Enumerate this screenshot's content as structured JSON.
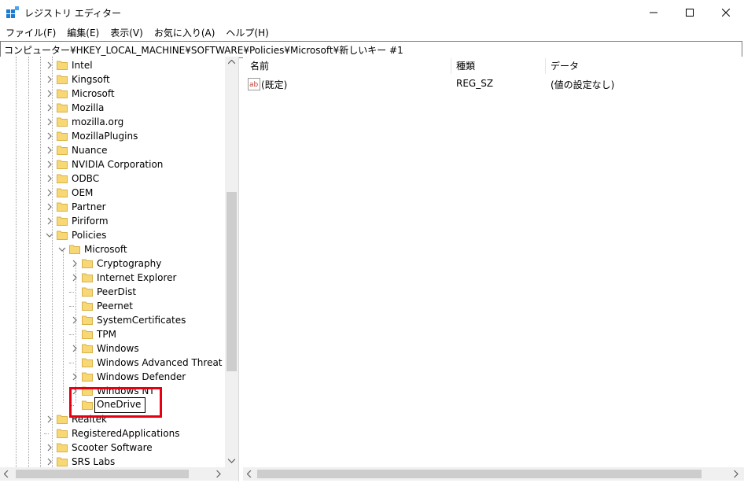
{
  "window": {
    "title": "レジストリ エディター"
  },
  "menu": [
    "ファイル(F)",
    "編集(E)",
    "表示(V)",
    "お気に入り(A)",
    "ヘルプ(H)"
  ],
  "address": "コンピューター¥HKEY_LOCAL_MACHINE¥SOFTWARE¥Policies¥Microsoft¥新しいキー #1",
  "tree": {
    "top_level": [
      "Intel",
      "Kingsoft",
      "Microsoft",
      "Mozilla",
      "mozilla.org",
      "MozillaPlugins",
      "Nuance",
      "NVIDIA Corporation",
      "ODBC",
      "OEM",
      "Partner",
      "Piriform",
      "Policies"
    ],
    "policies_child": "Microsoft",
    "microsoft_children": [
      "Cryptography",
      "Internet Explorer",
      "PeerDist",
      "Peernet",
      "SystemCertificates",
      "TPM",
      "Windows",
      "Windows Advanced Threat Pro",
      "Windows Defender",
      "Windows NT"
    ],
    "rename_value": "OneDrive",
    "after": [
      "Realtek",
      "RegisteredApplications",
      "Scooter Software",
      "SRS Labs"
    ]
  },
  "values": {
    "headers": {
      "name": "名前",
      "type": "種類",
      "data": "データ"
    },
    "rows": [
      {
        "name": "(既定)",
        "type": "REG_SZ",
        "data": "(値の設定なし)"
      }
    ]
  },
  "colors": {
    "highlight": "#e60012",
    "folder": "#f8d775"
  }
}
